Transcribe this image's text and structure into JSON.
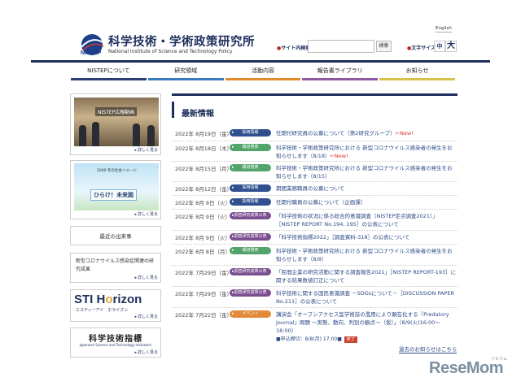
{
  "header": {
    "logo_jp": "科学技術・学術政策研究所",
    "logo_en": "National Institute of Science and Technology Policy",
    "english_link": "English",
    "search_label": "サイト内検索",
    "search_value": "",
    "search_button": "検索",
    "textsize_label": "文字サイズ",
    "textsize_mid": "中",
    "textsize_big": "大"
  },
  "nav": {
    "items": [
      {
        "label": "NISTEPについて"
      },
      {
        "label": "研究領域"
      },
      {
        "label": "活動内容"
      },
      {
        "label": "報告書ライブラリ"
      },
      {
        "label": "お知らせ"
      }
    ]
  },
  "sidebar": {
    "pr_caption": "NISTEP広報動画",
    "pr_more": "詳しく見る",
    "mirai_small": "2040 年の社会イメージ",
    "mirai_title": "ひらけ！未来図",
    "mirai_more": "詳しく見る",
    "recent_label": "最近の出来事",
    "covid_label": "新型コロナウイルス感染症関連の研究成果",
    "covid_more": "詳しく見る",
    "sti_brand_a": "STI H",
    "sti_brand_o": "o",
    "sti_brand_b": "rizon",
    "sti_kana": "エスティーアイ　ホライズン",
    "sti_more": "詳しく見る",
    "ind_brand": "科学技術指標",
    "ind_sub": "Japanese Science and Technology Indicators",
    "ind_more": "詳しく見る"
  },
  "news": {
    "title": "最新情報",
    "items": [
      {
        "date": "2022年 8月19日（金）",
        "tag": "採用情報",
        "text": "任期付研究員の公募について（第2研究グループ）",
        "new": "←New!"
      },
      {
        "date": "2022年 8月18日（木）",
        "tag": "報道発表",
        "text": "科学技術・学術政策研究所における 新型コロナウイルス感染者の発生をお知らせします（8/18）",
        "new": "←New!"
      },
      {
        "date": "2022年 8月15日（月）",
        "tag": "報道発表",
        "text": "科学技術・学術政策研究所における 新型コロナウイルス感染者の発生をお知らせします（8/15）",
        "new": ""
      },
      {
        "date": "2022年 8月12日（金）",
        "tag": "採用情報",
        "text": "期間業務職員の公募について",
        "new": ""
      },
      {
        "date": "2022年 8月 9日（火）",
        "tag": "採用情報",
        "text": "任期付職員の公募について（企画課）",
        "new": ""
      },
      {
        "date": "2022年 8月 9日（火）",
        "tag": "調査研究成果公表",
        "text": "「科学技術の状況に係る総合的意識調査（NISTEP定点調査2021）」［NISTEP REPORT No.194, 195］の公表について",
        "new": ""
      },
      {
        "date": "2022年 8月 9日（火）",
        "tag": "調査研究成果公表",
        "text": "「科学技術指標2022」［調査資料-318］の公表について",
        "new": ""
      },
      {
        "date": "2022年 8月 8日（月）",
        "tag": "報道発表",
        "text": "科学技術・学術政策研究所における 新型コロナウイルス感染者の発生をお知らせします（8/8）",
        "new": ""
      },
      {
        "date": "2022年 7月29日（金）",
        "tag": "調査研究成果公表",
        "text": "「民間企業の研究活動に関する調査報告2021」［NISTEP REPORT-193］に関する結果数値訂正について",
        "new": ""
      },
      {
        "date": "2022年 7月29日（金）",
        "tag": "調査研究成果公表",
        "text": "科学技術に関する国民意識調査 －SDGsについて－［DISCUSSION PAPER No.211］の公表について",
        "new": ""
      },
      {
        "date": "2022年 7月22日（金）",
        "tag": "イベント",
        "text": "講演会「オープンアクセス型学術誌の濫用により顕在化する『Predatory Journal』問題 ～実態、動向、判別の観点～（仮）」（8/9(火)16:00～18:00）",
        "sub": "■申込締切：8/8(月) 17:00■",
        "deadline": "終了",
        "new": ""
      }
    ],
    "archive_link": "過去のお知らせはこちら"
  },
  "watermark": {
    "brand": "ReseMom",
    "tag": "リセマム"
  }
}
